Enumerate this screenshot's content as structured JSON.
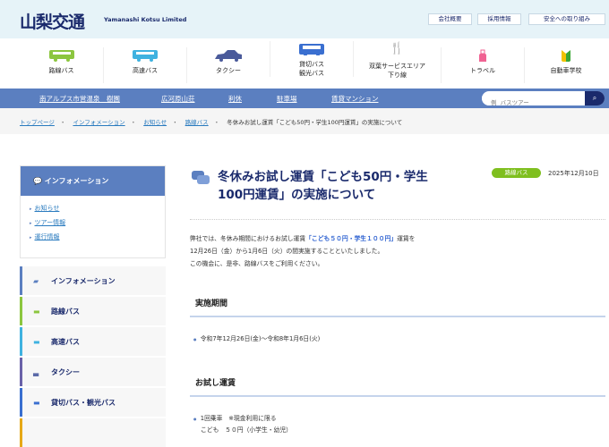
{
  "header": {
    "logo": "山梨交通",
    "logo_sub": "Yamanashi Kotsu Limited",
    "links": [
      "会社概要",
      "採用情報",
      "安全への取り組み"
    ]
  },
  "nav": [
    {
      "label": "路線バス",
      "icon": "bus-icon",
      "color": "#8cc63f"
    },
    {
      "label": "高速バス",
      "icon": "bus-icon",
      "color": "#3fb2e0"
    },
    {
      "label": "タクシー",
      "icon": "taxi-icon",
      "color": "#4a5a9a"
    },
    {
      "label": "貸切バス\n観光バス",
      "icon": "bus-icon",
      "color": "#3a6fd0"
    },
    {
      "label": "双葉サービスエリア\n下り線",
      "icon": "restaurant-icon",
      "color": "#e6a817"
    },
    {
      "label": "トラベル",
      "icon": "suitcase-icon",
      "color": "#f06292"
    },
    {
      "label": "自動車学校",
      "icon": "beginner-mark-icon",
      "color": "#3aa635"
    }
  ],
  "subnav": {
    "links": [
      "南アルプス市営温泉　樹園",
      "広河原山荘",
      "利休",
      "駐車場",
      "賃貸マンション"
    ],
    "search_placeholder": "例  バスツアー"
  },
  "breadcrumb": [
    "トップページ",
    "インフォメーション",
    "お知らせ",
    "路線バス",
    "冬休みお試し運賃「こども50円・学生100円運賃」の実施について"
  ],
  "sidebar": {
    "box_title": "インフォメーション",
    "box_links": [
      "お知らせ",
      "ツアー情報",
      "運行情報"
    ],
    "items": [
      {
        "label": "インフォメーション",
        "color": "#5b7fc0"
      },
      {
        "label": "路線バス",
        "color": "#8cc63f"
      },
      {
        "label": "高速バス",
        "color": "#3fb2e0"
      },
      {
        "label": "タクシー",
        "color": "#6a62a8"
      },
      {
        "label": "貸切バス・観光バス",
        "color": "#3a6fd0"
      }
    ]
  },
  "article": {
    "title": "冬休みお試し運賃「こども50円・学生100円運賃」の実施について",
    "badge": "路線バス",
    "date": "2025年12月10日",
    "p1a": "弊社では、冬休み期間におけるお試し運賃",
    "p1b": "「こども５０円・学生１００円」",
    "p1c": "運賃を",
    "p2": "12月26日（金）から1月6日（火）の間実施することといたしました。",
    "p3": "この機会に、是非、路線バスをご利用ください。",
    "h_period": "実施期間",
    "period": "令和7年12月26日(金)〜令和8年1月6日(火)",
    "h_fare": "お試し運賃",
    "fare1": "1回乗車　※現金利用に限る",
    "fare2": "こども　５０円（小学生・幼児）"
  }
}
